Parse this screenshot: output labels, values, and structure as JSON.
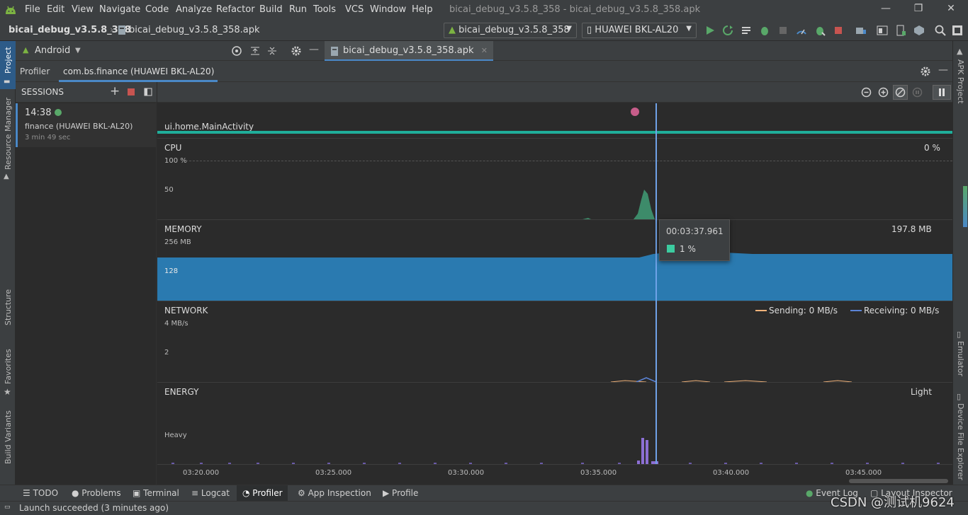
{
  "menu": [
    "File",
    "Edit",
    "View",
    "Navigate",
    "Code",
    "Analyze",
    "Refactor",
    "Build",
    "Run",
    "Tools",
    "VCS",
    "Window",
    "Help"
  ],
  "window_title": "bicai_debug_v3.5.8_358 - bicai_debug_v3.5.8_358.apk",
  "breadcrumb": {
    "project": "bicai_debug_v3.5.8_358",
    "file": "bicai_debug_v3.5.8_358.apk"
  },
  "run_config": "bicai_debug_v3.5.8_358",
  "device": "HUAWEI BKL-AL20",
  "project_view": "Android",
  "editor_tab": "bicai_debug_v3.5.8_358.apk",
  "left_strip": [
    "Project",
    "Resource Manager",
    "Structure",
    "Favorites",
    "Build Variants"
  ],
  "right_strip": [
    "APK Project",
    "Emulator",
    "Device File Explorer"
  ],
  "profiler": {
    "tab_profiler": "Profiler",
    "tab_process": "com.bs.finance (HUAWEI BKL-AL20)",
    "sessions_label": "SESSIONS",
    "session": {
      "time": "14:38",
      "name": "finance (HUAWEI BKL-AL20)",
      "duration": "3 min 49 sec"
    },
    "activity": "ui.home.MainActivity",
    "cpu": {
      "label": "CPU",
      "value": "0 %",
      "ticks": [
        "100 %",
        "50"
      ]
    },
    "memory": {
      "label": "MEMORY",
      "value": "197.8 MB",
      "ticks": [
        "256 MB",
        "128"
      ]
    },
    "network": {
      "label": "NETWORK",
      "ticks": [
        "4 MB/s",
        "2"
      ],
      "sending": "Sending: 0 MB/s",
      "receiving": "Receiving: 0 MB/s"
    },
    "energy": {
      "label": "ENERGY",
      "value": "Light",
      "ticks": [
        "Heavy"
      ]
    },
    "tooltip": {
      "time": "00:03:37.961",
      "value": "1 %"
    },
    "time_axis": [
      "03:20.000",
      "03:25.000",
      "03:30.000",
      "03:35.000",
      "03:40.000",
      "03:45.000"
    ]
  },
  "bottom_tools": [
    "TODO",
    "Problems",
    "Terminal",
    "Logcat",
    "Profiler",
    "App Inspection",
    "Profile"
  ],
  "bottom_right": [
    "Event Log",
    "Layout Inspector"
  ],
  "status": "Launch succeeded (3 minutes ago)",
  "watermark": "CSDN @测试机9624",
  "colors": {
    "accent": "#4a88c7",
    "cpu": "#3d8b6a",
    "memory": "#2a7ab0",
    "energy": "#8c6fd4",
    "sending": "#f0b27a",
    "receiving": "#5b83d6",
    "activity_bar": "#1fae9a"
  }
}
